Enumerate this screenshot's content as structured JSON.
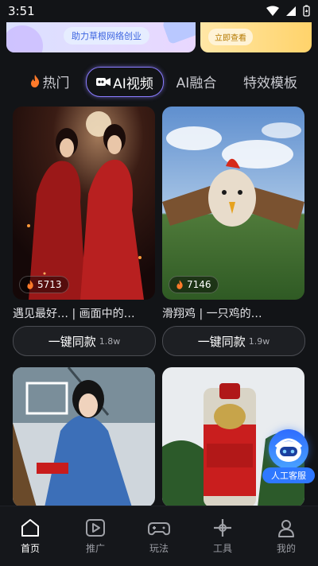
{
  "status_bar": {
    "time": "3:51"
  },
  "banners": {
    "left_text": "助力草根网络创业",
    "right_text": "立即查看"
  },
  "tabs": [
    {
      "label": "热门",
      "icon": "fire-icon"
    },
    {
      "label": "AI视频",
      "icon": "camera-icon",
      "active": true
    },
    {
      "label": "AI融合"
    },
    {
      "label": "特效模板"
    }
  ],
  "cards": [
    {
      "count": "5713",
      "caption": "遇见最好…   | 画面中的…",
      "button": "一键同款",
      "uses": "1.8w"
    },
    {
      "count": "7146",
      "caption": "滑翔鸡 | 一只鸡的…",
      "button": "一键同款",
      "uses": "1.9w"
    },
    {
      "count": "",
      "caption": "",
      "button": "",
      "uses": ""
    },
    {
      "count": "",
      "caption": "",
      "button": "",
      "uses": ""
    }
  ],
  "service": {
    "label": "人工客服"
  },
  "nav": [
    {
      "label": "首页",
      "icon": "home-icon",
      "active": true
    },
    {
      "label": "推广",
      "icon": "play-icon"
    },
    {
      "label": "玩法",
      "icon": "gamepad-icon"
    },
    {
      "label": "工具",
      "icon": "tools-icon"
    },
    {
      "label": "我的",
      "icon": "user-icon"
    }
  ],
  "colors": {
    "accent": "#8a7cff",
    "service_blue": "#2f78ff",
    "background": "#121417"
  }
}
